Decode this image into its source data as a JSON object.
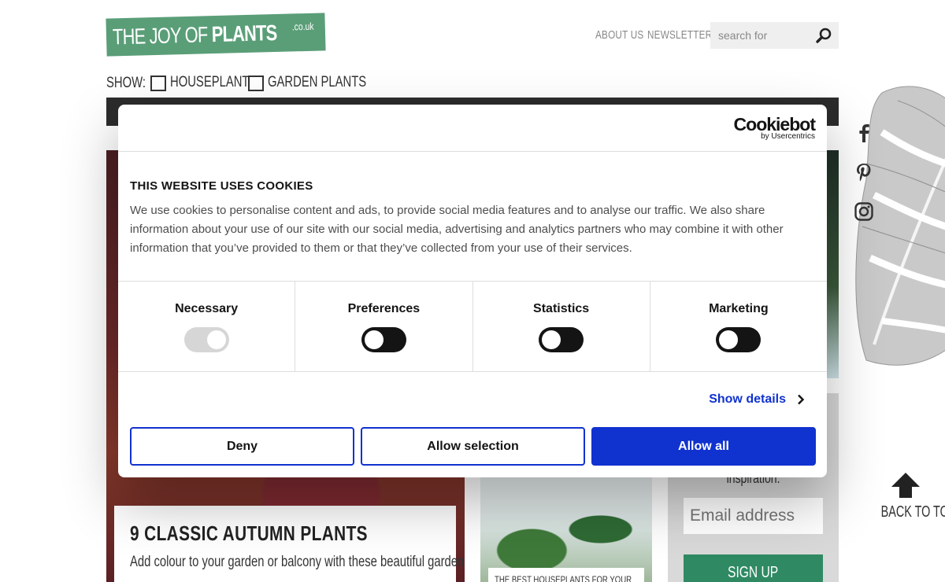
{
  "header": {
    "logo_main": "THE JOY OF",
    "logo_bold": "PLANTS",
    "logo_suffix": ".co.uk",
    "nav": [
      "ABOUT US",
      "NEWSLETTER"
    ],
    "search_placeholder": "search for"
  },
  "filter": {
    "label": "SHOW:",
    "options": [
      "HOUSEPLANTS",
      "GARDEN PLANTS"
    ]
  },
  "hero": {
    "title": "9 CLASSIC AUTUMN PLANTS",
    "description": "Add colour to your garden or balcony with these beautiful garden"
  },
  "article_teaser": {
    "caption": "THE BEST HOUSEPLANTS FOR YOUR"
  },
  "newsletter": {
    "text": "inspiration.",
    "email_placeholder": "Email address",
    "signup_label": "SIGN UP"
  },
  "social": [
    "facebook-icon",
    "pinterest-icon",
    "instagram-icon"
  ],
  "back_to_top": "BACK TO TOP",
  "cookie": {
    "brand": "Cookiebot",
    "brand_sub": "by Usercentrics",
    "title": "THIS WEBSITE USES COOKIES",
    "text": "We use cookies to personalise content and ads, to provide social media features and to analyse our traffic. We also share information about your use of our site with our social media, advertising and analytics partners who may combine it with other information that you’ve provided to them or that they’ve collected from your use of their services.",
    "toggles": [
      {
        "name": "Necessary",
        "state": "on-disabled"
      },
      {
        "name": "Preferences",
        "state": "off"
      },
      {
        "name": "Statistics",
        "state": "off"
      },
      {
        "name": "Marketing",
        "state": "off"
      }
    ],
    "show_details": "Show details",
    "deny": "Deny",
    "allow_selection": "Allow selection",
    "allow_all": "Allow all",
    "accent_color": "#1032cf"
  }
}
